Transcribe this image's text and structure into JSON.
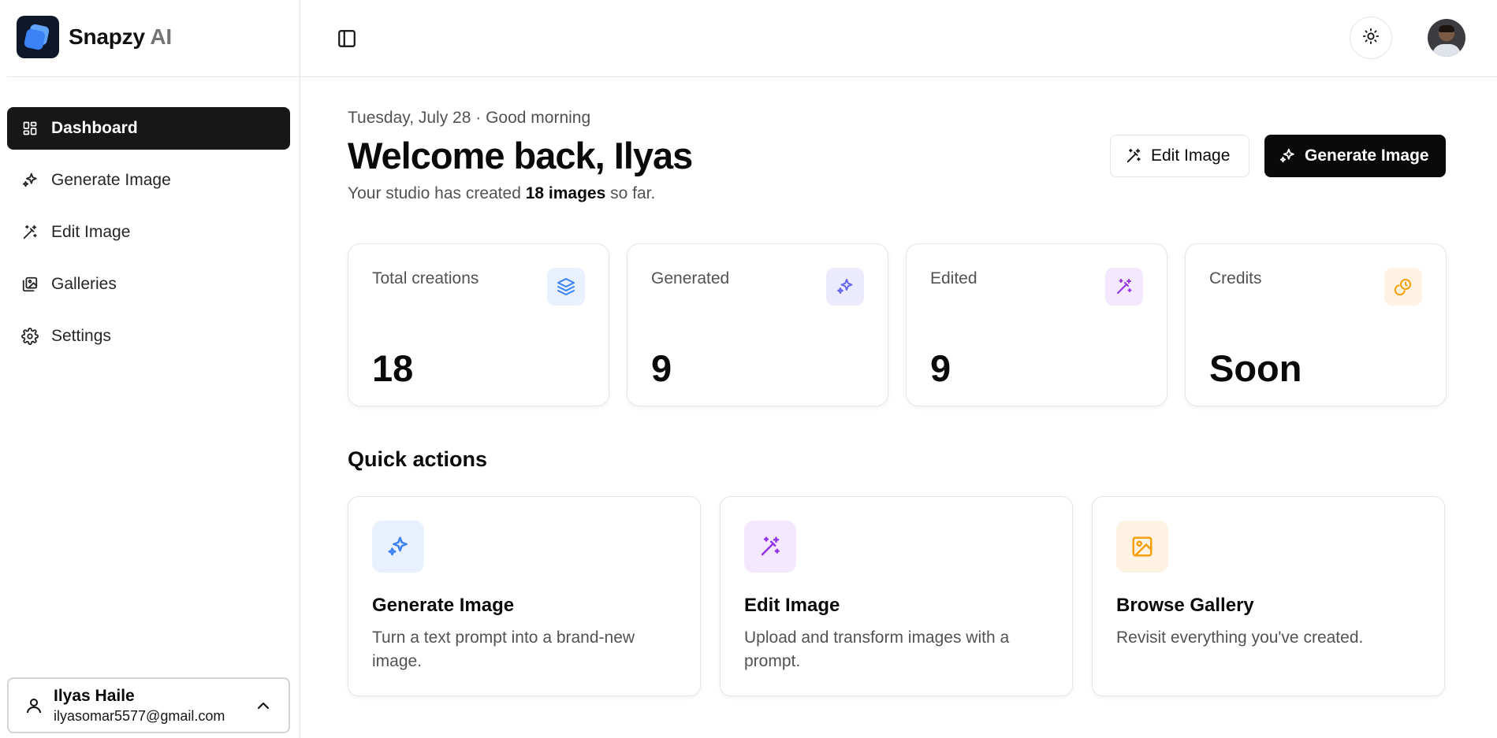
{
  "brand": {
    "name": "Snapzy",
    "suffix": "AI"
  },
  "sidebar": {
    "items": [
      {
        "label": "Dashboard",
        "icon": "dashboard-icon",
        "active": true
      },
      {
        "label": "Generate Image",
        "icon": "sparkles-icon"
      },
      {
        "label": "Edit Image",
        "icon": "wand-icon"
      },
      {
        "label": "Galleries",
        "icon": "gallery-icon"
      },
      {
        "label": "Settings",
        "icon": "gear-icon"
      }
    ],
    "user": {
      "name": "Ilyas Haile",
      "email": "ilyasomar5577@gmail.com"
    }
  },
  "header": {
    "toggle_icon": "sidebar-toggle-icon",
    "theme_icon": "sun-icon"
  },
  "main": {
    "date_line": "Tuesday, July 28 · Good morning",
    "welcome": "Welcome back, Ilyas",
    "subtitle": {
      "prefix": "Your studio has created",
      "count": "18 images",
      "suffix": "so far."
    },
    "buttons": {
      "edit": "Edit Image",
      "generate": "Generate Image"
    },
    "stats": [
      {
        "label": "Total creations",
        "value": "18",
        "icon": "layers-icon",
        "color": "#3b82f6",
        "bg": "#e8f1fd"
      },
      {
        "label": "Generated",
        "value": "9",
        "icon": "sparkles-icon",
        "color": "#6366f1",
        "bg": "#eceafd"
      },
      {
        "label": "Edited",
        "value": "9",
        "icon": "wand-icon",
        "color": "#9333ea",
        "bg": "#f3e8fd"
      },
      {
        "label": "Credits",
        "value": "Soon",
        "icon": "coins-icon",
        "color": "#f59e0b",
        "bg": "#fef3e2"
      }
    ],
    "quick_actions": {
      "title": "Quick actions",
      "items": [
        {
          "name": "Generate Image",
          "desc": "Turn a text prompt into a brand-new image.",
          "icon": "sparkles-icon",
          "color": "#3b82f6",
          "bg": "#e8f1fd"
        },
        {
          "name": "Edit Image",
          "desc": "Upload and transform images with a prompt.",
          "icon": "wand-icon",
          "color": "#9333ea",
          "bg": "#f3e8fd"
        },
        {
          "name": "Browse Gallery",
          "desc": "Revisit everything you've created.",
          "icon": "image-icon",
          "color": "#f59e0b",
          "bg": "#fef3e2"
        }
      ]
    }
  }
}
